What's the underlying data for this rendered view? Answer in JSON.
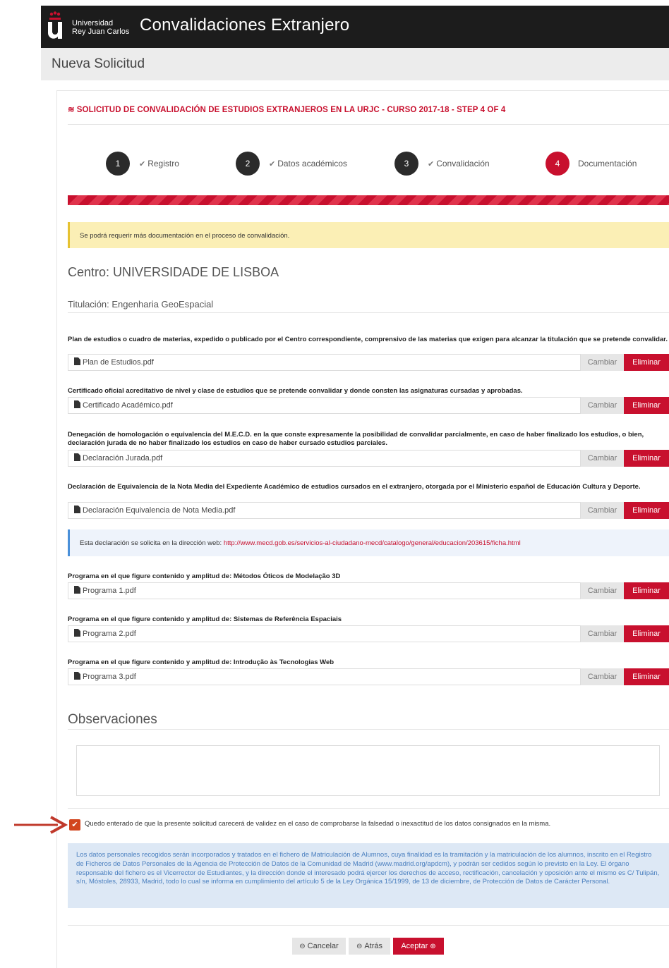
{
  "header": {
    "logo_letter": "u",
    "university_line1": "Universidad",
    "university_line2": "Rey Juan Carlos",
    "app_title": "Convalidaciones Extranjero"
  },
  "subheader": {
    "page_title": "Nueva Solicitud"
  },
  "form": {
    "title": "SOLICITUD DE CONVALIDACIÓN DE ESTUDIOS EXTRANJEROS EN LA URJC - CURSO 2017-18 - STEP 4 OF 4",
    "title_icon": "stack-icon",
    "steps": [
      {
        "number": "1",
        "label": "Registro",
        "done": true
      },
      {
        "number": "2",
        "label": "Datos académicos",
        "done": true
      },
      {
        "number": "3",
        "label": "Convalidación",
        "done": true
      },
      {
        "number": "4",
        "label": "Documentación",
        "done": false
      }
    ],
    "progress_fraction": 1.0,
    "notice": "Se podrá requerir más documentación en el proceso de convalidación.",
    "centro": "Centro: UNIVERSIDADE DE LISBOA",
    "titulacion": "Titulación: Engenharia GeoEspacial",
    "documents": [
      {
        "label": "Plan de estudios o cuadro de materias, expedido o publicado por el Centro correspondiente, comprensivo de las materias que exigen para alcanzar la titulación que se pretende convalidar.",
        "file": "Plan de Estudios.pdf"
      },
      {
        "label": "Certificado oficial acreditativo de nivel y clase de estudios que se pretende convalidar y donde consten las asignaturas cursadas y aprobadas.",
        "file": "Certificado Académico.pdf"
      },
      {
        "label": "Denegación de homologación o equivalencia del M.E.C.D. en la que conste expresamente la posibilidad de convalidar parcialmente, en caso de haber finalizado los estudios, o bien, declaración jurada de no haber finalizado los estudios en caso de haber cursado estudios parciales.",
        "file": "Declaración Jurada.pdf"
      },
      {
        "label": "Declaración de Equivalencia de la Nota Media del Expediente Académico de estudios cursados en el extranjero, otorgada por el Ministerio español de Educación Cultura y Deporte.",
        "file": "Declaración Equivalencia de Nota Media.pdf"
      },
      {
        "label": "Programa en el que figure contenido y amplitud de: Métodos Óticos de Modelação 3D",
        "file": "Programa 1.pdf"
      },
      {
        "label": "Programa en el que figure contenido y amplitud de: Sistemas de Referência Espaciais",
        "file": "Programa 2.pdf"
      },
      {
        "label": "Programa en el que figure contenido y amplitud de: Introdução às Tecnologias Web",
        "file": "Programa 3.pdf"
      }
    ],
    "btn_change": "Cambiar",
    "btn_delete": "Eliminar",
    "info_prefix": "Esta declaración se solicita en la dirección web: ",
    "info_link": "http://www.mecd.gob.es/servicios-al-ciudadano-mecd/catalogo/general/educacion/203615/ficha.html",
    "observaciones_title": "Observaciones",
    "observaciones_value": "",
    "accept_checked": true,
    "accept_text": "Quedo enterado de que la presente solicitud carecerá de validez en el caso de comprobarse la falsedad o inexactitud de los datos consignados en la misma.",
    "privacy_text": "Los datos personales recogidos serán incorporados y tratados en el fichero de Matriculación de Alumnos, cuya finalidad es la tramitación y la matriculación de los alumnos, inscrito en el Registro de Ficheros de Datos Personales de la Agencia de Protección de Datos de la Comunidad de Madrid (www.madrid.org/apdcm), y podrán ser cedidos según lo previsto en la Ley. El órgano responsable del fichero es el Vicerrector de Estudiantes, y la dirección donde el interesado podrá ejercer los derechos de acceso, rectificación, cancelación y oposición ante el mismo es C/ Tulipán, s/n, Móstoles, 28933, Madrid, todo lo cual se informa en cumplimiento del artículo 5 de la Ley Orgánica 15/1999, de 13 de diciembre, de Protección de Datos de Carácter Personal.",
    "buttons": {
      "cancel": "Cancelar",
      "back": "Atrás",
      "accept": "Aceptar"
    }
  },
  "colors": {
    "brand_red": "#c8102e",
    "header_bg": "#1c1c1c",
    "notice_bg": "#fbefb5",
    "info_bg": "#eef3fb",
    "privacy_bg": "#dde8f5",
    "checkbox": "#d2451e"
  }
}
